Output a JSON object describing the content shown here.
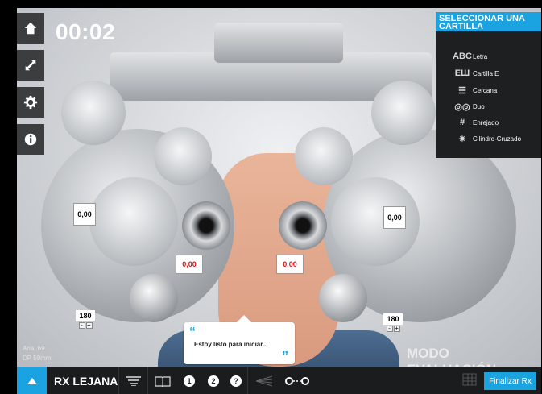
{
  "timer": "00:02",
  "tools": [
    {
      "icon": "home-icon"
    },
    {
      "icon": "expand-icon"
    },
    {
      "icon": "gear-icon"
    },
    {
      "icon": "info-icon"
    }
  ],
  "chart_panel": {
    "title": "SELECCIONAR UNA CARTILLA",
    "items": [
      {
        "glyph": "ABC",
        "label": "Letra",
        "icon": "letter-chart-icon"
      },
      {
        "glyph": "EШ",
        "label": "Cartilla E",
        "icon": "e-chart-icon"
      },
      {
        "glyph": "☰",
        "label": "Cercana",
        "icon": "near-chart-icon"
      },
      {
        "glyph": "◎◎",
        "label": "Duo",
        "icon": "duo-chart-icon"
      },
      {
        "glyph": "#",
        "label": "Enrejado",
        "icon": "grid-chart-icon"
      },
      {
        "glyph": "✷",
        "label": "Cilindro-Cruzado",
        "icon": "cross-cylinder-icon"
      }
    ]
  },
  "values": {
    "left_sphere": "0,00",
    "right_sphere": "0,00",
    "left_cyl": "0,00",
    "right_cyl": "0,00",
    "left_axis": "180",
    "right_axis": "180",
    "minus": "-",
    "plus": "+"
  },
  "patient": {
    "name": "Ana, 69",
    "dp": "DP 59mm"
  },
  "mode_label": "MODO EVALUACIÓN",
  "bubble": {
    "open_quote": "“",
    "text": "Estoy listo para iniciar...",
    "close_quote": "”"
  },
  "bottom_bar": {
    "rx_label": "RX LEJANA",
    "btn1": "1",
    "btn2": "2",
    "help": "?",
    "finalize": "Finalizar Rx"
  },
  "colors": {
    "accent": "#1aa3e0",
    "value_red": "#d4161c"
  }
}
